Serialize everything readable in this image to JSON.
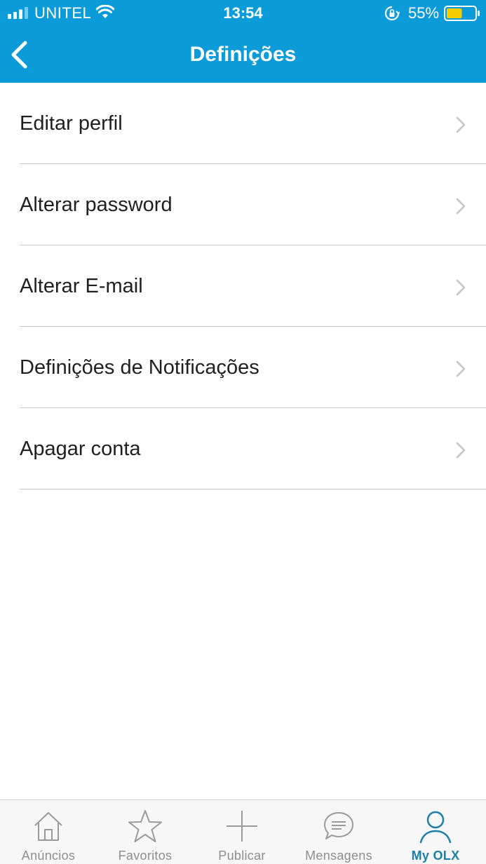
{
  "status_bar": {
    "carrier": "UNITEL",
    "time": "13:54",
    "battery_percent": "55%",
    "battery_level": 0.55,
    "icons": [
      "signal-icon",
      "wifi-icon",
      "orientation-lock-icon",
      "battery-icon"
    ]
  },
  "nav": {
    "title": "Definições",
    "back_icon": "chevron-left-icon"
  },
  "settings": {
    "items": [
      {
        "label": "Editar perfil"
      },
      {
        "label": "Alterar password"
      },
      {
        "label": "Alterar E-mail"
      },
      {
        "label": "Definições de Notificações"
      },
      {
        "label": "Apagar conta"
      }
    ],
    "chevron_icon": "chevron-right-icon"
  },
  "tab_bar": {
    "tabs": [
      {
        "label": "Anúncios",
        "icon": "home-icon",
        "active": false
      },
      {
        "label": "Favoritos",
        "icon": "star-icon",
        "active": false
      },
      {
        "label": "Publicar",
        "icon": "plus-icon",
        "active": false
      },
      {
        "label": "Mensagens",
        "icon": "chat-icon",
        "active": false
      },
      {
        "label": "My OLX",
        "icon": "user-icon",
        "active": true
      }
    ]
  },
  "colors": {
    "header_bg": "#0b9bd9",
    "active_tab": "#1b7fa8",
    "inactive_tab": "#8e8e8e",
    "battery_fill": "#f5cc00"
  }
}
